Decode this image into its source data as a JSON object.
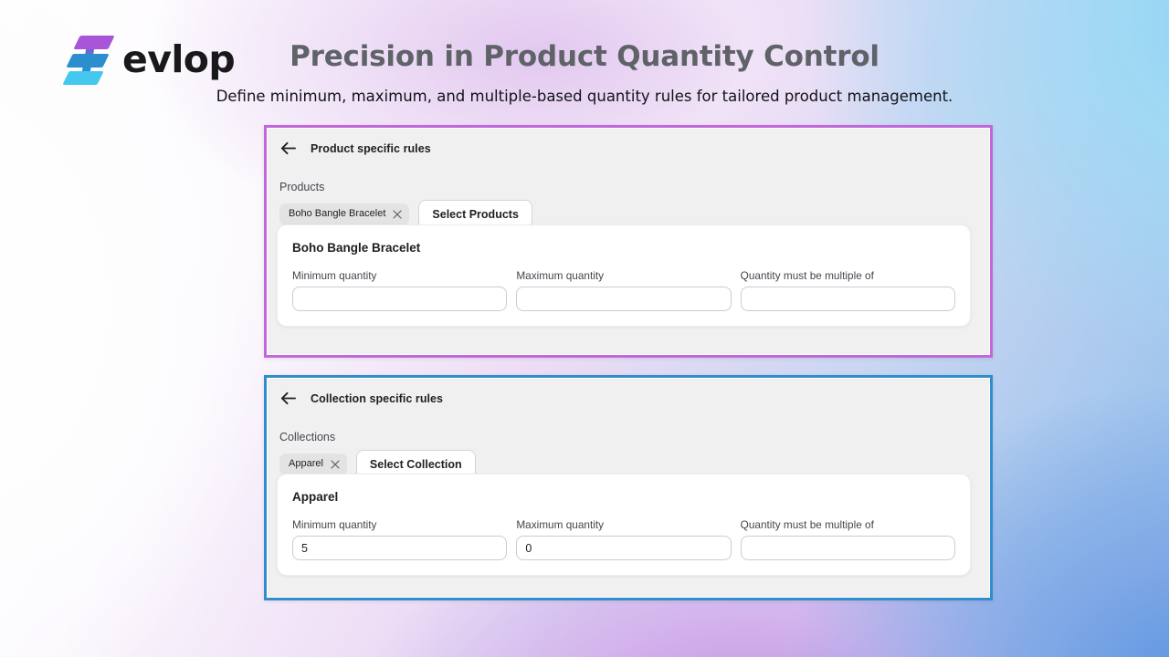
{
  "brand": {
    "logo_text": "evlop",
    "logo_icon": "stacked-bars-logo",
    "colors": {
      "purple": "#a855d8",
      "blue": "#2b8ecf",
      "cyan": "#44c8f0"
    }
  },
  "header": {
    "title": "Precision in Product Quantity Control",
    "subtitle": "Define minimum, maximum, and multiple-based quantity rules for tailored product management.",
    "title_color": "#5f6368",
    "subtitle_color": "#111318"
  },
  "panels": [
    {
      "id": "product-specific-rules",
      "accent_color": "#c167d9",
      "back_icon": "arrow-left-icon",
      "title": "Product specific rules",
      "selector": {
        "label": "Products",
        "tags": [
          {
            "label": "Boho Bangle Bracelet",
            "remove_icon": "close-icon"
          }
        ],
        "button_label": "Select Products"
      },
      "card": {
        "title": "Boho Bangle Bracelet",
        "fields": [
          {
            "label": "Minimum quantity",
            "value": "",
            "placeholder": ""
          },
          {
            "label": "Maximum quantity",
            "value": "",
            "placeholder": ""
          },
          {
            "label": "Quantity must be multiple of",
            "value": "",
            "placeholder": ""
          }
        ]
      }
    },
    {
      "id": "collection-specific-rules",
      "accent_color": "#2f8ecb",
      "back_icon": "arrow-left-icon",
      "title": "Collection specific rules",
      "selector": {
        "label": "Collections",
        "tags": [
          {
            "label": "Apparel",
            "remove_icon": "close-icon"
          }
        ],
        "button_label": "Select Collection"
      },
      "card": {
        "title": "Apparel",
        "fields": [
          {
            "label": "Minimum quantity",
            "value": "5",
            "placeholder": ""
          },
          {
            "label": "Maximum quantity",
            "value": "0",
            "placeholder": ""
          },
          {
            "label": "Quantity must be multiple of",
            "value": "",
            "placeholder": ""
          }
        ]
      }
    }
  ]
}
